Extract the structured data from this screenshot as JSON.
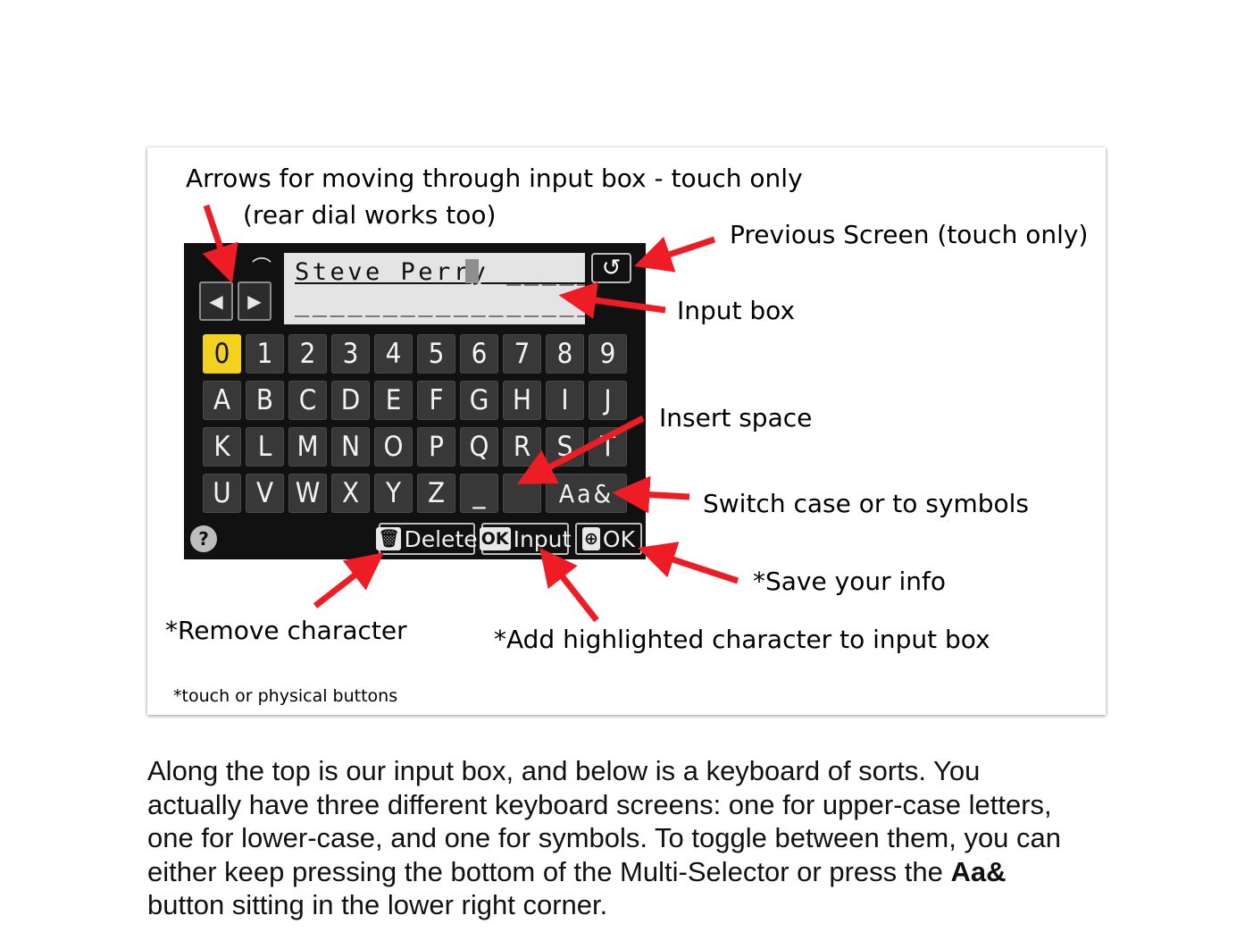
{
  "annotations": {
    "arrows_line1": "Arrows for moving through input box - touch only",
    "arrows_line2": "(rear dial works too)",
    "previous_screen": "Previous Screen (touch only)",
    "input_box": "Input box",
    "insert_space": "Insert space",
    "switch_case": "Switch case or to symbols",
    "save_info": "*Save your info",
    "remove_character": "*Remove character",
    "add_character": "*Add highlighted character to input box",
    "footnote": "*touch or physical buttons"
  },
  "screen": {
    "input_line1": "Steve Perry ______",
    "input_line2": "_________________",
    "left_arrow": "◀",
    "right_arrow": "▶",
    "back_icon": "↺",
    "dial_icon": "⌒",
    "help": "?",
    "keys_row0": [
      "0",
      "1",
      "2",
      "3",
      "4",
      "5",
      "6",
      "7",
      "8",
      "9"
    ],
    "keys_row1": [
      "A",
      "B",
      "C",
      "D",
      "E",
      "F",
      "G",
      "H",
      "I",
      "J"
    ],
    "keys_row2": [
      "K",
      "L",
      "M",
      "N",
      "O",
      "P",
      "Q",
      "R",
      "S",
      "T"
    ],
    "keys_row3": [
      "U",
      "V",
      "W",
      "X",
      "Y",
      "Z",
      "_",
      " "
    ],
    "case_key": "Aa&",
    "selected_key": "0",
    "delete_label": "Delete",
    "delete_icon": "🗑",
    "input_badge": "OK",
    "input_label": "Input",
    "ok_icon": "⊕",
    "ok_label": "OK",
    "accent_color": "#f2d11f",
    "arrow_color": "#ee1c24"
  },
  "paragraph": {
    "line1": "Along the top is our input box, and below is a keyboard of sorts. You",
    "line2": "actually have three different keyboard screens: one for upper-case letters,",
    "line3": "one for lower-case, and one for symbols. To toggle between them, you can",
    "line4_pre": "either keep pressing the bottom of the Multi-Selector or press the ",
    "line4_bold": "Aa&",
    "line5": "button sitting in the lower right corner."
  }
}
